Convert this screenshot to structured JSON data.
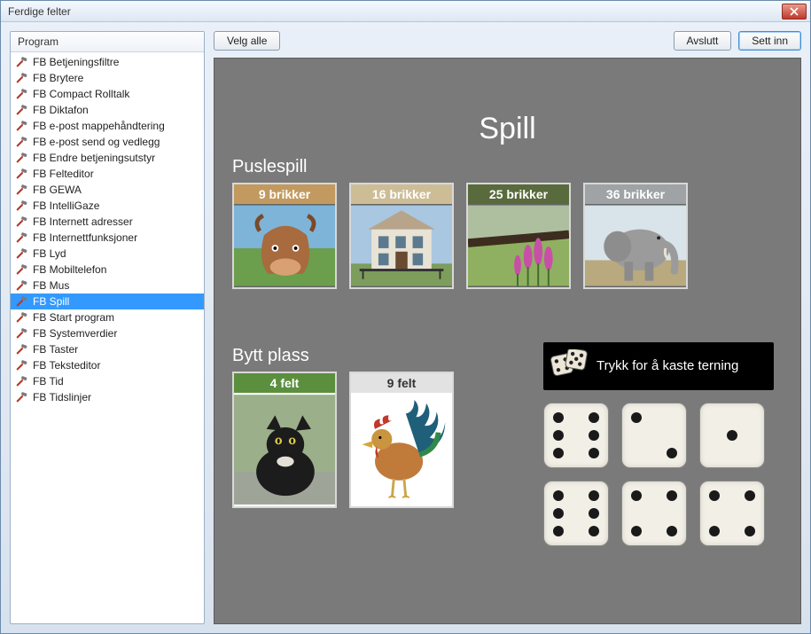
{
  "window": {
    "title": "Ferdige felter"
  },
  "sidebar": {
    "header": "Program",
    "items": [
      {
        "label": "FB Betjeningsfiltre",
        "selected": false
      },
      {
        "label": "FB Brytere",
        "selected": false
      },
      {
        "label": "FB Compact Rolltalk",
        "selected": false
      },
      {
        "label": "FB Diktafon",
        "selected": false
      },
      {
        "label": "FB e-post mappehåndtering",
        "selected": false
      },
      {
        "label": "FB e-post send og vedlegg",
        "selected": false
      },
      {
        "label": "FB Endre betjeningsutstyr",
        "selected": false
      },
      {
        "label": "FB Felteditor",
        "selected": false
      },
      {
        "label": "FB GEWA",
        "selected": false
      },
      {
        "label": "FB IntelliGaze",
        "selected": false
      },
      {
        "label": "FB Internett adresser",
        "selected": false
      },
      {
        "label": "FB Internettfunksjoner",
        "selected": false
      },
      {
        "label": "FB Lyd",
        "selected": false
      },
      {
        "label": "FB Mobiltelefon",
        "selected": false
      },
      {
        "label": "FB Mus",
        "selected": false
      },
      {
        "label": "FB Spill",
        "selected": true
      },
      {
        "label": "FB Start program",
        "selected": false
      },
      {
        "label": "FB Systemverdier",
        "selected": false
      },
      {
        "label": "FB Taster",
        "selected": false
      },
      {
        "label": "FB Teksteditor",
        "selected": false
      },
      {
        "label": "FB Tid",
        "selected": false
      },
      {
        "label": "FB Tidslinjer",
        "selected": false
      }
    ]
  },
  "toolbar": {
    "select_all": "Velg alle",
    "exit": "Avslutt",
    "insert": "Sett inn"
  },
  "canvas": {
    "title": "Spill",
    "puzzle_section": "Puslespill",
    "puzzle_cards": [
      {
        "label": "9 brikker",
        "header_class": "hc-tan",
        "img": "cow"
      },
      {
        "label": "16 brikker",
        "header_class": "hc-beige",
        "img": "house"
      },
      {
        "label": "25 brikker",
        "header_class": "hc-olive",
        "img": "flowers"
      },
      {
        "label": "36 brikker",
        "header_class": "hc-gray",
        "img": "elephant"
      }
    ],
    "swap_section": "Bytt plass",
    "swap_cards": [
      {
        "label": "4 felt",
        "header_class": "hc-green",
        "img": "cat"
      },
      {
        "label": "9 felt",
        "header_class": "hc-white",
        "img": "rooster"
      }
    ],
    "dice_banner": "Trykk for å kaste terning",
    "dice_values": [
      6,
      2,
      1,
      6,
      4,
      4
    ]
  }
}
